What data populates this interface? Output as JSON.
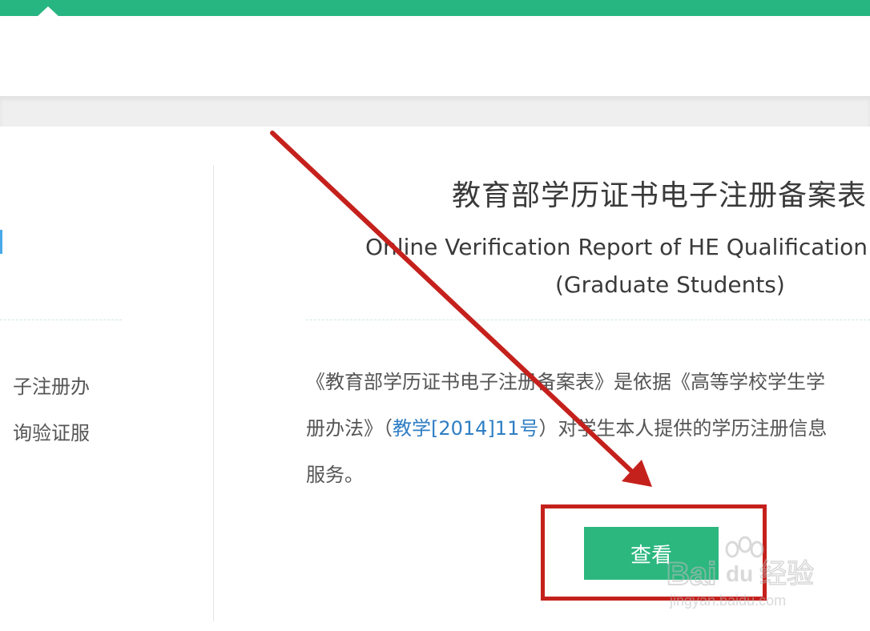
{
  "colors": {
    "header_green": "#27b582",
    "button_green": "#2cb77f",
    "link_blue": "#2f7ec4",
    "annotation_red": "#c5211c"
  },
  "left_card": {
    "line1": "子注册办",
    "line2": "询验证服"
  },
  "card": {
    "title": "教育部学历证书电子注册备案表",
    "subtitle": "Online Verification Report of HE Qualification C",
    "subtitle2": "(Graduate Students)",
    "desc_part1": "《教育部学历证书电子注册备案表》是依据《高等学校学生学",
    "desc_part2": "册办法》（",
    "desc_link": "教学[2014]11号",
    "desc_part3": "）对学生本人提供的学历注册信息",
    "desc_part4": "服务。",
    "view_label": "查看"
  },
  "watermark": {
    "brand": "Bai",
    "brand2": "du",
    "product": "经验",
    "url": "jingyan.baidu.com"
  }
}
